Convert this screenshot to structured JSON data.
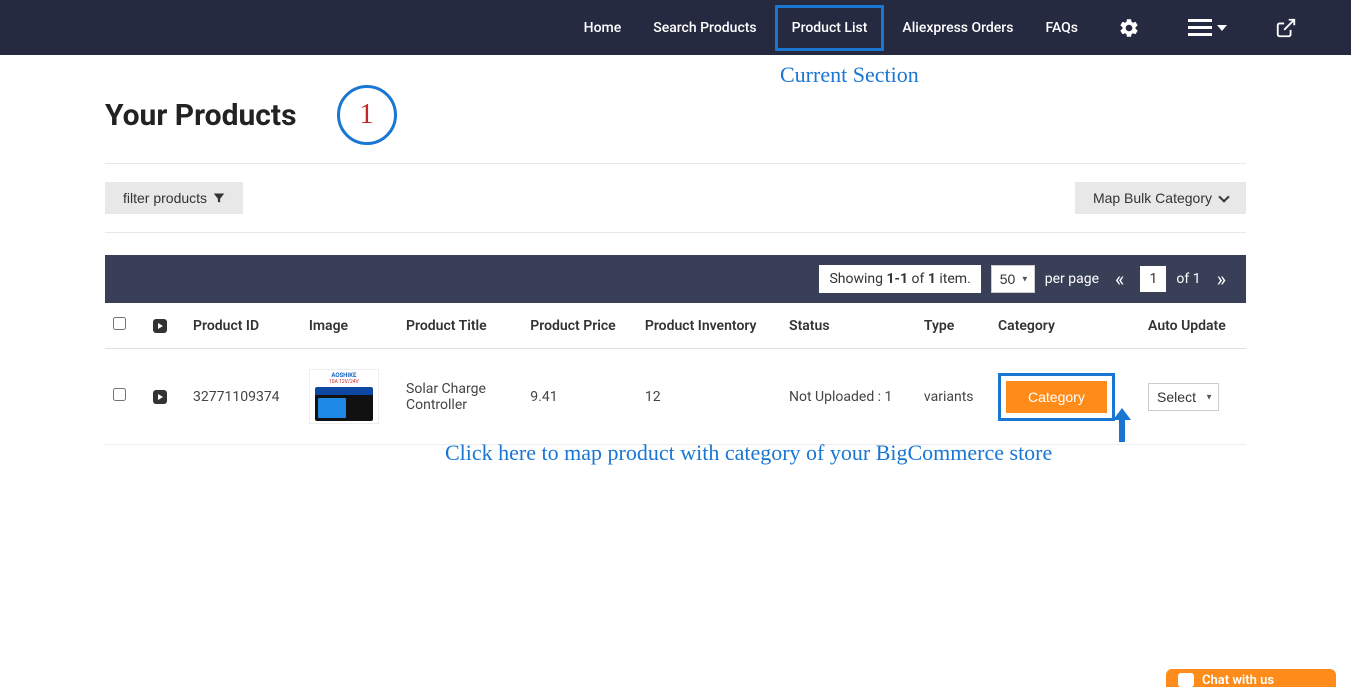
{
  "nav": {
    "home": "Home",
    "search": "Search Products",
    "product_list": "Product List",
    "orders": "Aliexpress Orders",
    "faqs": "FAQs"
  },
  "annotations": {
    "current_section": "Current Section",
    "badge_number": "1",
    "click_here": "Click here to map product with category of your BigCommerce store"
  },
  "page": {
    "title": "Your Products"
  },
  "toolbar": {
    "filter_label": "filter products",
    "map_bulk_label": "Map Bulk Category"
  },
  "pagination": {
    "showing_prefix": "Showing ",
    "range": "1-1",
    "of_text": " of ",
    "total": "1",
    "item_suffix": " item.",
    "per_page_value": "50",
    "per_page_label": "per page",
    "page_num": "1",
    "of_pages_prefix": "of ",
    "of_pages": "1"
  },
  "table": {
    "headers": {
      "product_id": "Product ID",
      "image": "Image",
      "title": "Product Title",
      "price": "Product Price",
      "inventory": "Product Inventory",
      "status": "Status",
      "type": "Type",
      "category": "Category",
      "auto_update": "Auto Update"
    },
    "row": {
      "product_id": "32771109374",
      "title": "Solar Charge Controller",
      "price": "9.41",
      "inventory": "12",
      "status": "Not Uploaded : 1",
      "type": "variants",
      "category_btn": "Category",
      "auto_update_value": "Select",
      "image_brand": "AOSHIKE",
      "image_sub": "10A 12V/24V"
    }
  },
  "chat": {
    "label": "Chat with us"
  }
}
